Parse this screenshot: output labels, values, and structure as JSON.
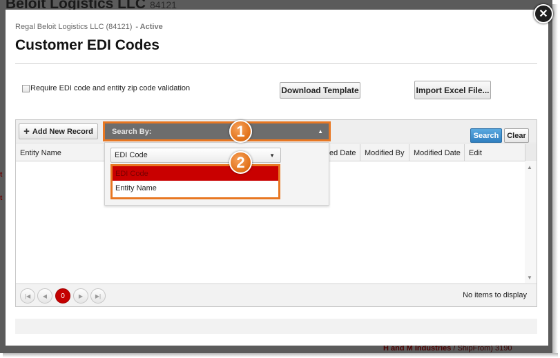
{
  "background": {
    "title": "Beloit Logistics LLC",
    "title_code": "84121",
    "footer_company": "H and M Industries",
    "footer_detail": " / ShipFrom) 3190",
    "side_letter_1": "t",
    "side_letter_2": "t"
  },
  "modal": {
    "close_symbol": "✕",
    "subtitle": "Regal Beloit Logistics LLC (84121)",
    "status": "- Active",
    "title": "Customer EDI Codes",
    "checkbox_label": "Require EDI code and entity zip code validation",
    "download_template_label": "Download Template",
    "import_excel_label": "Import Excel File..."
  },
  "grid": {
    "add_new_label": "Add New Record",
    "search_label": "Search",
    "clear_label": "Clear",
    "columns": {
      "entity_name": "Entity Name",
      "created_date": "ed Date",
      "modified_by": "Modified By",
      "modified_date": "Modified Date",
      "edit": "Edit"
    },
    "pager": {
      "current_page": "0",
      "no_items": "No items to display"
    }
  },
  "search_by": {
    "label": "Search By:",
    "selected_value": "EDI Code",
    "options": [
      "EDI Code",
      "Entity Name"
    ],
    "callout_1": "1",
    "callout_2": "2"
  },
  "colors": {
    "accent_orange": "#e87722",
    "search_blue": "#2f7fc0",
    "selected_red": "#c90000"
  }
}
